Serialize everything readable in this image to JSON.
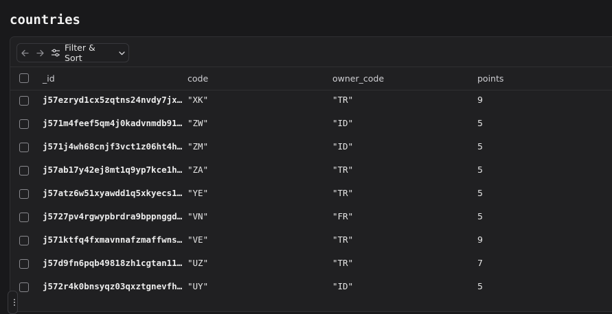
{
  "page": {
    "title": "countries"
  },
  "toolbar": {
    "back_icon": "arrow-left-icon",
    "forward_icon": "arrow-right-icon",
    "filter_label": "Filter & Sort",
    "filter_icon": "sliders-icon",
    "dropdown_icon": "chevron-down-icon"
  },
  "table": {
    "columns": [
      "_id",
      "code",
      "owner_code",
      "points"
    ],
    "rows": [
      {
        "id": "j57ezryd1cx5zqtns24nvdy7jx…",
        "code": "\"XK\"",
        "owner_code": "\"TR\"",
        "points": "9"
      },
      {
        "id": "j571m4feef5qm4j0kadvnmdb91…",
        "code": "\"ZW\"",
        "owner_code": "\"ID\"",
        "points": "5"
      },
      {
        "id": "j571j4wh68cnjf3vct1z06ht4h…",
        "code": "\"ZM\"",
        "owner_code": "\"ID\"",
        "points": "5"
      },
      {
        "id": "j57ab17y42ej8mt1q9yp7kce1h…",
        "code": "\"ZA\"",
        "owner_code": "\"TR\"",
        "points": "5"
      },
      {
        "id": "j57atz6w51xyawdd1q5xkyecs1…",
        "code": "\"YE\"",
        "owner_code": "\"TR\"",
        "points": "5"
      },
      {
        "id": "j5727pv4rgwypbrdra9bppnggd…",
        "code": "\"VN\"",
        "owner_code": "\"FR\"",
        "points": "5"
      },
      {
        "id": "j571ktfq4fxmavnnafzmaffwns…",
        "code": "\"VE\"",
        "owner_code": "\"TR\"",
        "points": "9"
      },
      {
        "id": "j57d9fn6pqb49818zh1cgtan11…",
        "code": "\"UZ\"",
        "owner_code": "\"TR\"",
        "points": "7"
      },
      {
        "id": "j572r4k0bnsyqz03qxztgnevfh…",
        "code": "\"UY\"",
        "owner_code": "\"ID\"",
        "points": "5"
      }
    ]
  }
}
